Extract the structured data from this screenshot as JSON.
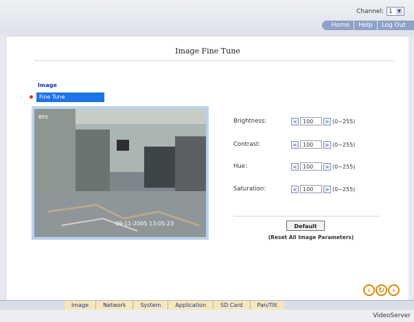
{
  "header": {
    "channel_label": "Channel:",
    "channel_value": "1",
    "links": [
      "Home",
      "Help",
      "Log Out"
    ]
  },
  "page": {
    "title": "Image Fine Tune"
  },
  "sidebar": {
    "heading": "Image",
    "selected_item": "Fine Tune"
  },
  "preview": {
    "overlay_top": "BRS",
    "overlay_bottom": "09-11-2005  13:05:23"
  },
  "controls": [
    {
      "label": "Brightness:",
      "value": "100",
      "range": "(0~255)"
    },
    {
      "label": "Contrast:",
      "value": "100",
      "range": "(0~255)"
    },
    {
      "label": "Hue:",
      "value": "100",
      "range": "(0~255)"
    },
    {
      "label": "Saturation:",
      "value": "100",
      "range": "(0~255)"
    }
  ],
  "default_section": {
    "button_label": "Default",
    "note": "(Reset All Image Parameters)"
  },
  "bottom_tabs": [
    "Image",
    "Network",
    "System",
    "Application",
    "SD Card",
    "Pan/Tilt"
  ],
  "footer": {
    "brand": "VideoServer"
  },
  "colors": {
    "accent": "#1e73e8",
    "nav_link": "#1a2f9c",
    "nav_icons": "#d68a00"
  },
  "icons": {
    "nav_back": "back-icon",
    "nav_refresh": "refresh-icon",
    "nav_forward": "forward-icon"
  }
}
